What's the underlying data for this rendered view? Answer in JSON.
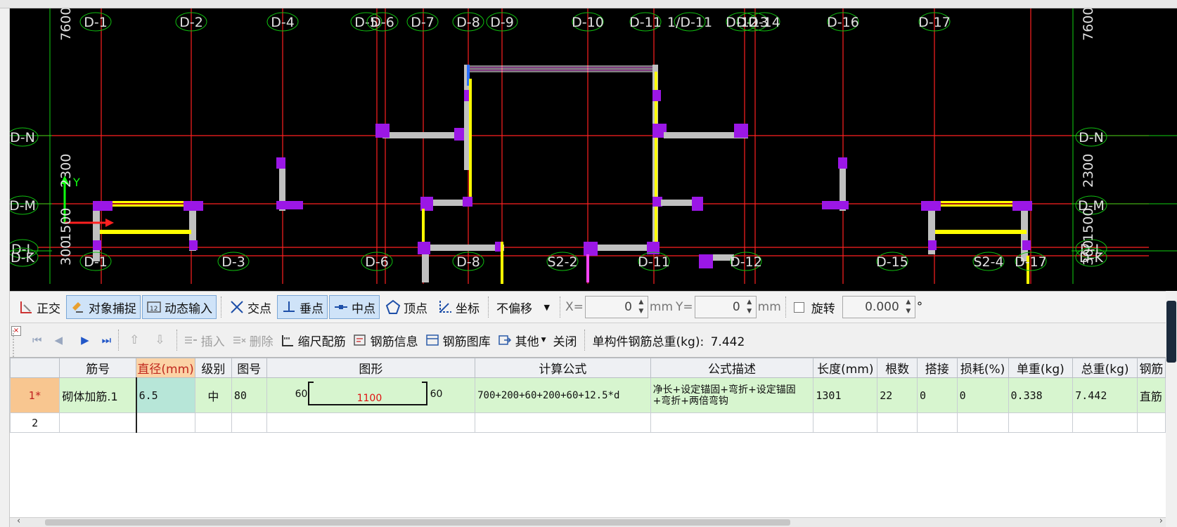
{
  "cad": {
    "axes_top": [
      "D-1",
      "D-2",
      "D-4",
      "D-5",
      "D-6",
      "D-7",
      "D-8",
      "D-9",
      "D-10",
      "D-11",
      "1/D-11",
      "D-12",
      "D-13",
      "D-14",
      "D-16",
      "D-17"
    ],
    "axes_bottom": [
      "D-1",
      "D-3",
      "D-6",
      "D-8",
      "S2-2",
      "D-11",
      "D-12",
      "D-15",
      "S2-4",
      "D-17"
    ],
    "axes_left": [
      "D-N",
      "D-M",
      "D-L",
      "D-K"
    ],
    "axes_right": [
      "D-N",
      "D-M",
      "D-L",
      "D-K"
    ],
    "dims_left": [
      "7600",
      "2300",
      "1500",
      "300"
    ],
    "dims_right": [
      "7600",
      "2300",
      "1500",
      "300"
    ],
    "y_axis_label": "Y"
  },
  "snap_toolbar": {
    "ortho": "正交",
    "object_snap": "对象捕捉",
    "dynamic_input": "动态输入",
    "intersection": "交点",
    "perpendicular": "垂点",
    "midpoint": "中点",
    "vertex": "顶点",
    "coordinate": "坐标",
    "offset_mode": "不偏移",
    "x_label": "X=",
    "x_value": "0",
    "x_unit": "mm",
    "y_label": "Y=",
    "y_value": "0",
    "y_unit": "mm",
    "rotate_label": "旋转",
    "rotate_value": "0.000",
    "degree": "°"
  },
  "rebar_toolbar": {
    "insert": "插入",
    "delete": "删除",
    "scale_rebar": "缩尺配筋",
    "rebar_info": "钢筋信息",
    "rebar_library": "钢筋图库",
    "other": "其他",
    "close": "关闭",
    "total_label": "单构件钢筋总重(kg):",
    "total_value": "7.442"
  },
  "grid": {
    "headers": [
      "",
      "筋号",
      "直径(mm)",
      "级别",
      "图号",
      "图形",
      "计算公式",
      "公式描述",
      "长度(mm)",
      "根数",
      "搭接",
      "损耗(%)",
      "单重(kg)",
      "总重(kg)",
      "钢筋"
    ],
    "rows": [
      {
        "num": "1*",
        "name": "砌体加筋.1",
        "diameter": "6.5",
        "grade": "中",
        "fig_no": "80",
        "shape_left": "60",
        "shape_mid": "1100",
        "shape_right": "60",
        "formula": "700+200+60+200+60+12.5*d",
        "desc": "净长+设定锚固+弯折+设定锚固+弯折+两倍弯钩",
        "length": "1301",
        "count": "22",
        "lap": "0",
        "loss": "0",
        "unit_weight": "0.338",
        "total_weight": "7.442",
        "type": "直筋"
      },
      {
        "num": "2"
      }
    ]
  }
}
